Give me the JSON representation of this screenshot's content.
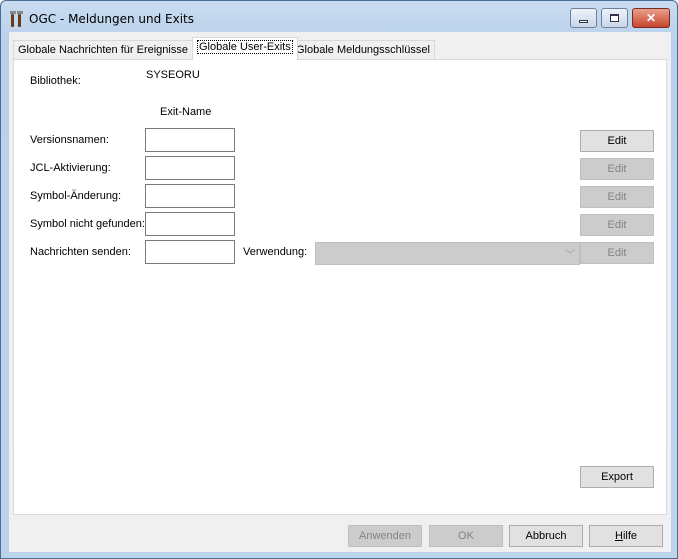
{
  "window": {
    "title": "OGC - Meldungen und Exits",
    "icon": "tools-icon"
  },
  "tabs": [
    {
      "label": "Globale Nachrichten für Ereignisse"
    },
    {
      "label": "Globale User-Exits",
      "active": true
    },
    {
      "label": "Globale Meldungsschlüssel"
    }
  ],
  "form": {
    "library_label": "Bibliothek:",
    "library_value": "SYSEORU",
    "column_header": "Exit-Name",
    "rows": [
      {
        "label": "Versionsnamen:",
        "value": "",
        "edit": "Edit",
        "edit_enabled": true
      },
      {
        "label": "JCL-Aktivierung:",
        "value": "",
        "edit": "Edit",
        "edit_enabled": false
      },
      {
        "label": "Symbol-Änderung:",
        "value": "",
        "edit": "Edit",
        "edit_enabled": false
      },
      {
        "label": "Symbol nicht gefunden:",
        "value": "",
        "edit": "Edit",
        "edit_enabled": false
      },
      {
        "label": "Nachrichten senden:",
        "value": "",
        "edit": "Edit",
        "edit_enabled": false
      }
    ],
    "usage_label": "Verwendung:",
    "usage_value": "",
    "export": "Export"
  },
  "footer": {
    "apply": "Anwenden",
    "ok": "OK",
    "cancel": "Abbruch",
    "help": "Hilfe"
  }
}
